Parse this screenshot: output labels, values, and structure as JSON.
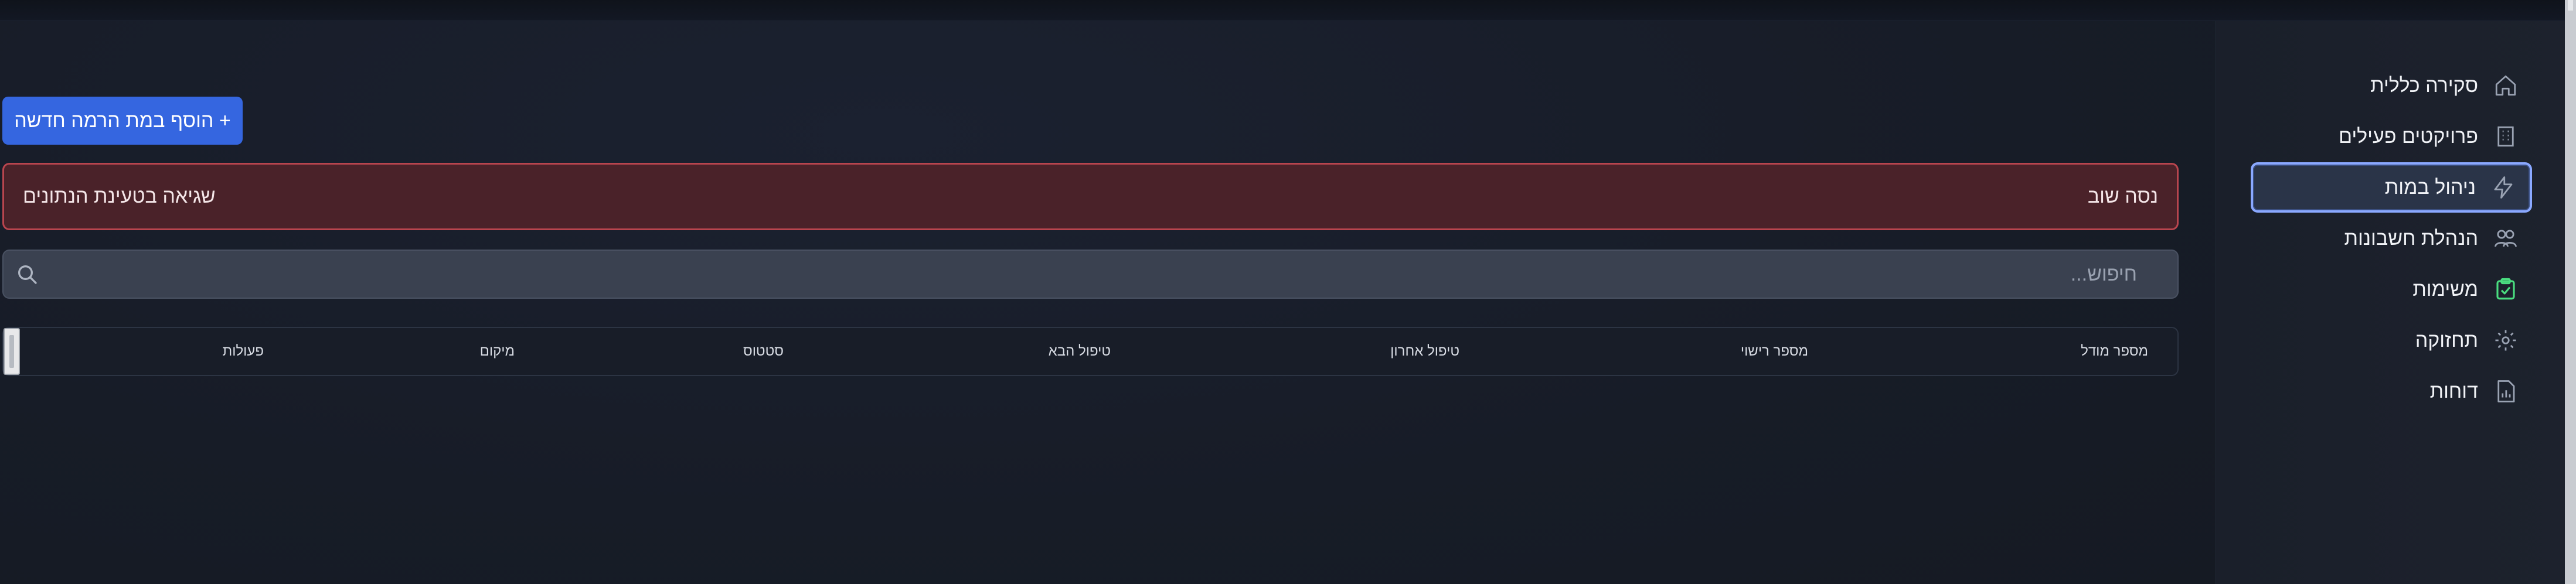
{
  "sidebar": {
    "items": [
      {
        "label": "סקירה כללית",
        "icon": "home-icon"
      },
      {
        "label": "פרויקטים פעילים",
        "icon": "building-icon"
      },
      {
        "label": "ניהול במות",
        "icon": "lightning-icon",
        "active": true
      },
      {
        "label": "הנהלת חשבונות",
        "icon": "users-icon"
      },
      {
        "label": "משימות",
        "icon": "clipboard-check-icon"
      },
      {
        "label": "תחזוקה",
        "icon": "gear-icon"
      },
      {
        "label": "דוחות",
        "icon": "report-icon"
      }
    ]
  },
  "toolbar": {
    "add_label": "+ הוסף במת הרמה חדשה"
  },
  "error": {
    "message": "שגיאה בטעינת הנתונים",
    "retry_label": "נסה שוב"
  },
  "search": {
    "placeholder": "חיפוש...",
    "value": ""
  },
  "table": {
    "columns": [
      "מספר מודל",
      "מספר רישוי",
      "טיפול אחרון",
      "טיפול הבא",
      "סטטוס",
      "מיקום",
      "פעולות"
    ]
  },
  "colors": {
    "primary": "#3566e0",
    "error_bg": "#4a2229",
    "error_border": "#b8454e",
    "active_border": "#8aa8ff",
    "tasks_icon": "#4ade80"
  }
}
